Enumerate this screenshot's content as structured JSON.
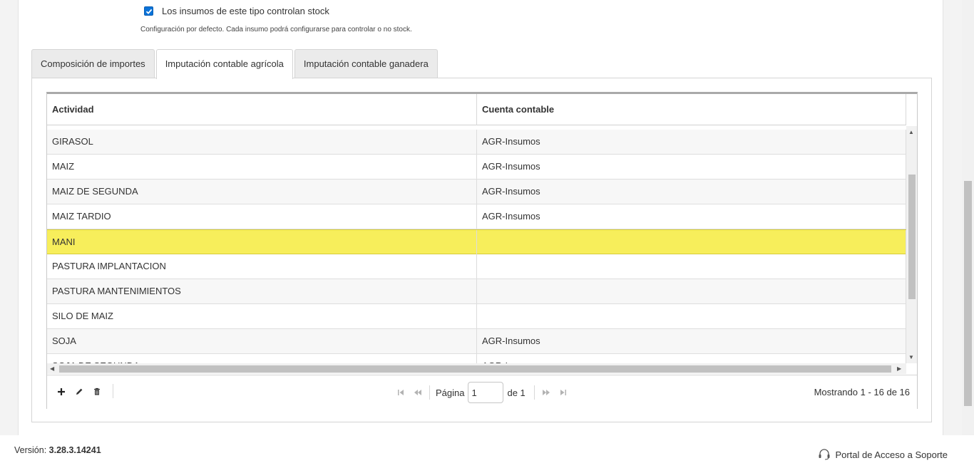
{
  "stock": {
    "checked": true,
    "label": "Los insumos de este tipo controlan stock",
    "hint": "Configuración por defecto. Cada insumo podrá configurarse para controlar o no stock."
  },
  "tabs": [
    {
      "label": "Composición de importes",
      "active": false
    },
    {
      "label": "Imputación contable agrícola",
      "active": true
    },
    {
      "label": "Imputación contable ganadera",
      "active": false
    }
  ],
  "grid": {
    "columns": [
      "Actividad",
      "Cuenta contable"
    ],
    "rows": [
      {
        "actividad": "GIRASOL",
        "cuenta": "AGR-Insumos"
      },
      {
        "actividad": "MAIZ",
        "cuenta": "AGR-Insumos"
      },
      {
        "actividad": "MAIZ DE SEGUNDA",
        "cuenta": "AGR-Insumos"
      },
      {
        "actividad": "MAIZ TARDIO",
        "cuenta": "AGR-Insumos"
      },
      {
        "actividad": "MANI",
        "cuenta": ""
      },
      {
        "actividad": "PASTURA IMPLANTACION",
        "cuenta": ""
      },
      {
        "actividad": "PASTURA MANTENIMIENTOS",
        "cuenta": ""
      },
      {
        "actividad": "SILO DE MAIZ",
        "cuenta": ""
      },
      {
        "actividad": "SOJA",
        "cuenta": "AGR-Insumos"
      },
      {
        "actividad": "SOJA DE SEGUNDA",
        "cuenta": "AGR-Insumos"
      }
    ],
    "highlighted_row": 4,
    "highlight_color": "#f7ee5b"
  },
  "pager": {
    "page_label": "Página",
    "page_value": "1",
    "of_label": "de 1",
    "showing": "Mostrando 1 - 16 de 16"
  },
  "toolbar": {
    "icons": [
      "add-icon",
      "edit-icon",
      "delete-icon"
    ]
  },
  "footer": {
    "version_label": "Versión:",
    "version_value": "3.28.3.14241",
    "support_label": "Portal de Acceso a Soporte"
  }
}
